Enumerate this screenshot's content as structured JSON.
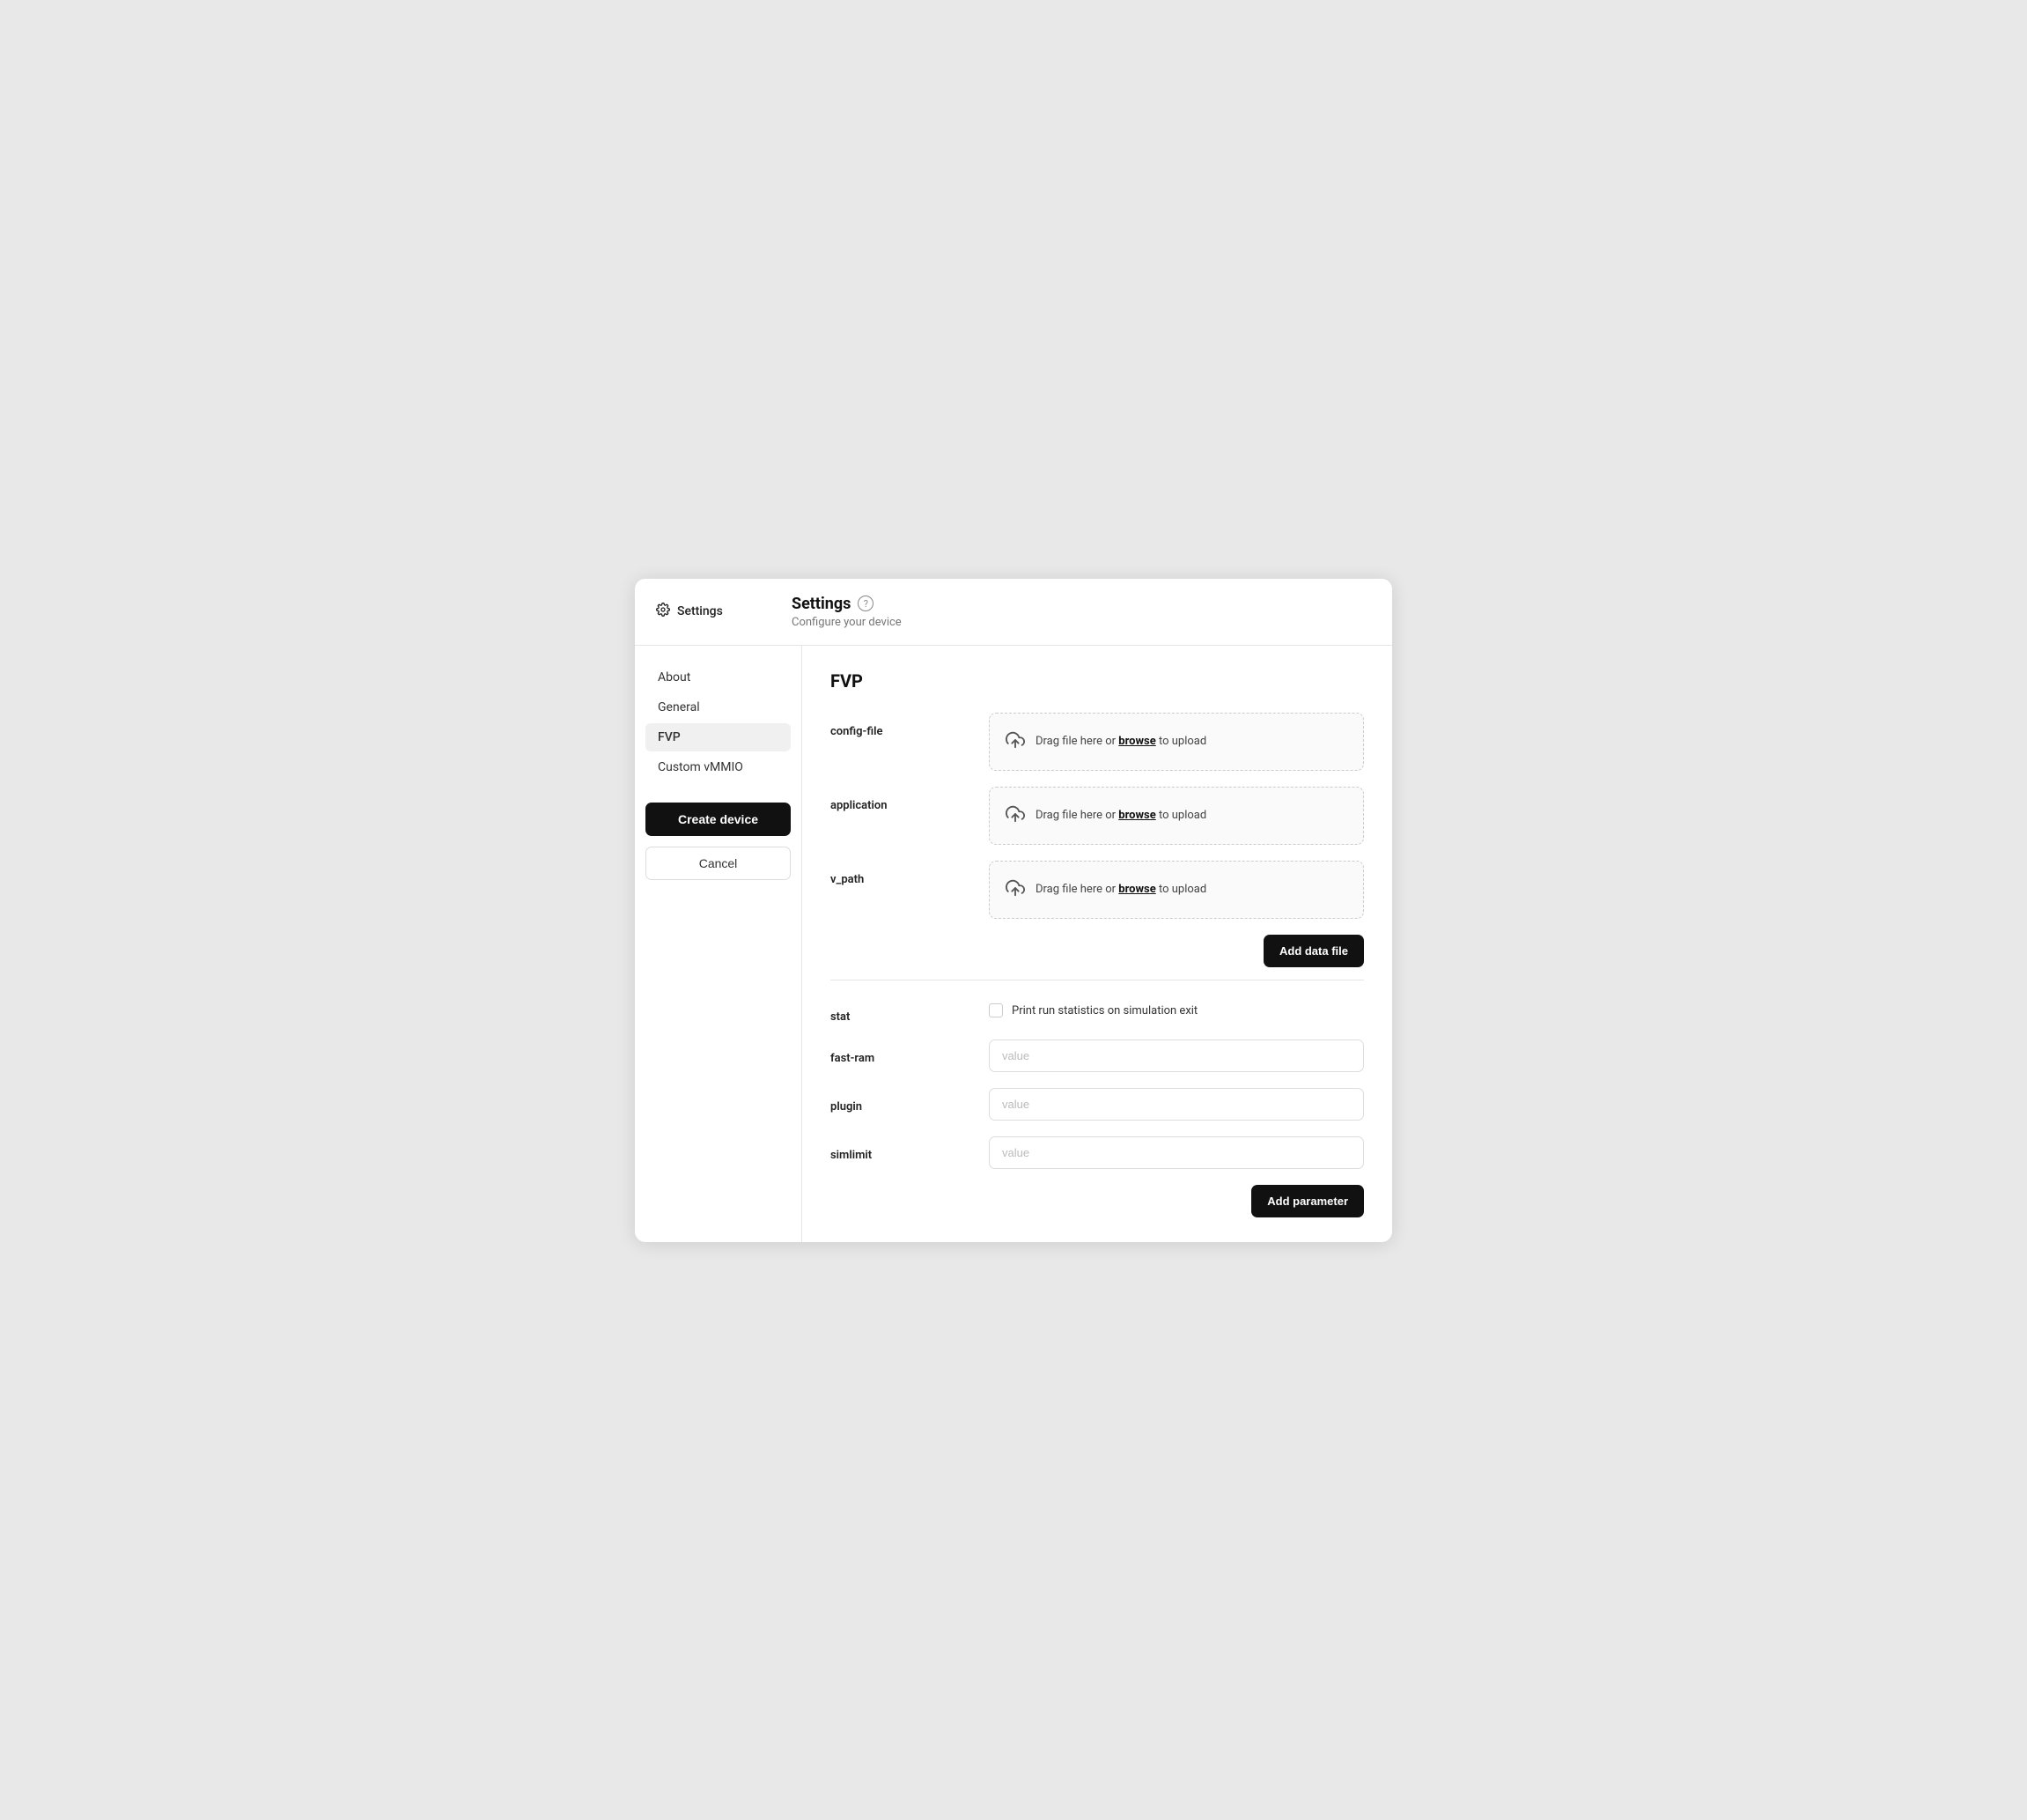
{
  "window": {
    "title": "Settings"
  },
  "topbar": {
    "sidebar_label": "Settings",
    "page_title": "Settings",
    "page_subtitle": "Configure your device",
    "help_icon_label": "?"
  },
  "sidebar": {
    "items": [
      {
        "id": "about",
        "label": "About",
        "active": false
      },
      {
        "id": "general",
        "label": "General",
        "active": false
      },
      {
        "id": "fvp",
        "label": "FVP",
        "active": true
      },
      {
        "id": "custom-vmmio",
        "label": "Custom vMMIO",
        "active": false
      }
    ],
    "create_button_label": "Create device",
    "cancel_button_label": "Cancel"
  },
  "main": {
    "section_title": "FVP",
    "file_fields": [
      {
        "id": "config-file",
        "label": "config-file",
        "upload_text": "Drag file here or",
        "browse_text": "browse",
        "upload_suffix": "to upload"
      },
      {
        "id": "application",
        "label": "application",
        "upload_text": "Drag file here or",
        "browse_text": "browse",
        "upload_suffix": "to upload"
      },
      {
        "id": "v_path",
        "label": "v_path",
        "upload_text": "Drag file here or",
        "browse_text": "browse",
        "upload_suffix": "to upload"
      }
    ],
    "add_data_file_label": "Add data file",
    "stat_label": "stat",
    "stat_description": "Print run statistics on simulation exit",
    "text_fields": [
      {
        "id": "fast-ram",
        "label": "fast-ram",
        "placeholder": "value"
      },
      {
        "id": "plugin",
        "label": "plugin",
        "placeholder": "value"
      },
      {
        "id": "simlimit",
        "label": "simlimit",
        "placeholder": "value"
      }
    ],
    "add_parameter_label": "Add parameter"
  }
}
